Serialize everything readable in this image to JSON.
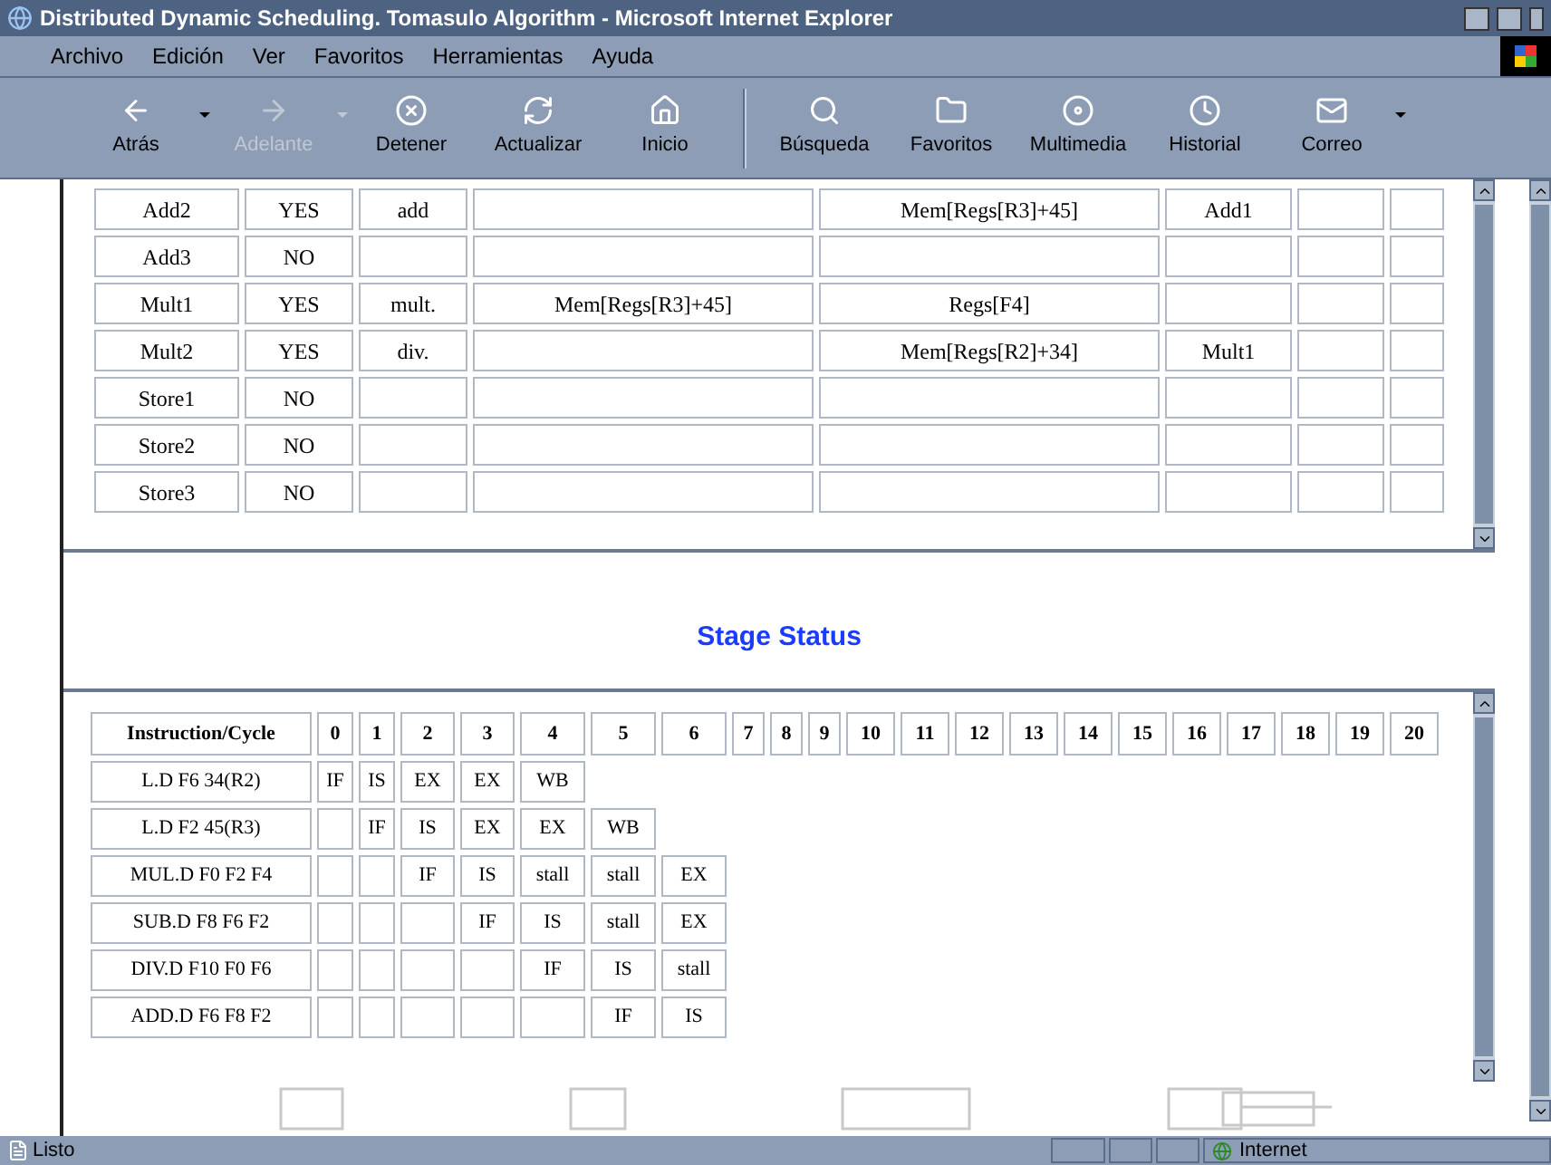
{
  "window": {
    "title": "Distributed Dynamic Scheduling. Tomasulo Algorithm - Microsoft Internet Explorer"
  },
  "menu": [
    "Archivo",
    "Edición",
    "Ver",
    "Favoritos",
    "Herramientas",
    "Ayuda"
  ],
  "toolbar": [
    {
      "label": "Atrás",
      "kind": "back",
      "disabled": false,
      "dropdown": true
    },
    {
      "label": "Adelante",
      "kind": "forward",
      "disabled": true,
      "dropdown": true
    },
    {
      "label": "Detener",
      "kind": "stop",
      "disabled": false,
      "dropdown": false
    },
    {
      "label": "Actualizar",
      "kind": "refresh",
      "disabled": false,
      "dropdown": false
    },
    {
      "label": "Inicio",
      "kind": "home",
      "disabled": false,
      "dropdown": false
    },
    {
      "label": "Búsqueda",
      "kind": "search",
      "disabled": false,
      "dropdown": false
    },
    {
      "label": "Favoritos",
      "kind": "favorites",
      "disabled": false,
      "dropdown": false
    },
    {
      "label": "Multimedia",
      "kind": "media",
      "disabled": false,
      "dropdown": false
    },
    {
      "label": "Historial",
      "kind": "history",
      "disabled": false,
      "dropdown": false
    },
    {
      "label": "Correo",
      "kind": "mail",
      "disabled": false,
      "dropdown": true
    }
  ],
  "reservation_table": {
    "rows": [
      [
        "Add2",
        "YES",
        "add",
        "",
        "Mem[Regs[R3]+45]",
        "Add1",
        "",
        ""
      ],
      [
        "Add3",
        "NO",
        "",
        "",
        "",
        "",
        "",
        ""
      ],
      [
        "Mult1",
        "YES",
        "mult.",
        "Mem[Regs[R3]+45]",
        "Regs[F4]",
        "",
        "",
        ""
      ],
      [
        "Mult2",
        "YES",
        "div.",
        "",
        "Mem[Regs[R2]+34]",
        "Mult1",
        "",
        ""
      ],
      [
        "Store1",
        "NO",
        "",
        "",
        "",
        "",
        "",
        ""
      ],
      [
        "Store2",
        "NO",
        "",
        "",
        "",
        "",
        "",
        ""
      ],
      [
        "Store3",
        "NO",
        "",
        "",
        "",
        "",
        "",
        ""
      ]
    ]
  },
  "stage_status": {
    "heading": "Stage Status",
    "columns": [
      "Instruction/Cycle",
      "0",
      "1",
      "2",
      "3",
      "4",
      "5",
      "6",
      "7",
      "8",
      "9",
      "10",
      "11",
      "12",
      "13",
      "14",
      "15",
      "16",
      "17",
      "18",
      "19",
      "20"
    ],
    "rows": [
      [
        "L.D F6 34(R2)",
        "IF",
        "IS",
        "EX",
        "EX",
        "WB"
      ],
      [
        "L.D F2 45(R3)",
        "",
        "IF",
        "IS",
        "EX",
        "EX",
        "WB"
      ],
      [
        "MUL.D F0 F2 F4",
        "",
        "",
        "IF",
        "IS",
        "stall",
        "stall",
        "EX"
      ],
      [
        "SUB.D F8 F6 F2",
        "",
        "",
        "",
        "IF",
        "IS",
        "stall",
        "EX"
      ],
      [
        "DIV.D F10 F0 F6",
        "",
        "",
        "",
        "",
        "IF",
        "IS",
        "stall"
      ],
      [
        "ADD.D F6 F8 F2",
        "",
        "",
        "",
        "",
        "",
        "IF",
        "IS"
      ]
    ]
  },
  "status_bar": {
    "text": "Listo",
    "zone": "Internet"
  }
}
